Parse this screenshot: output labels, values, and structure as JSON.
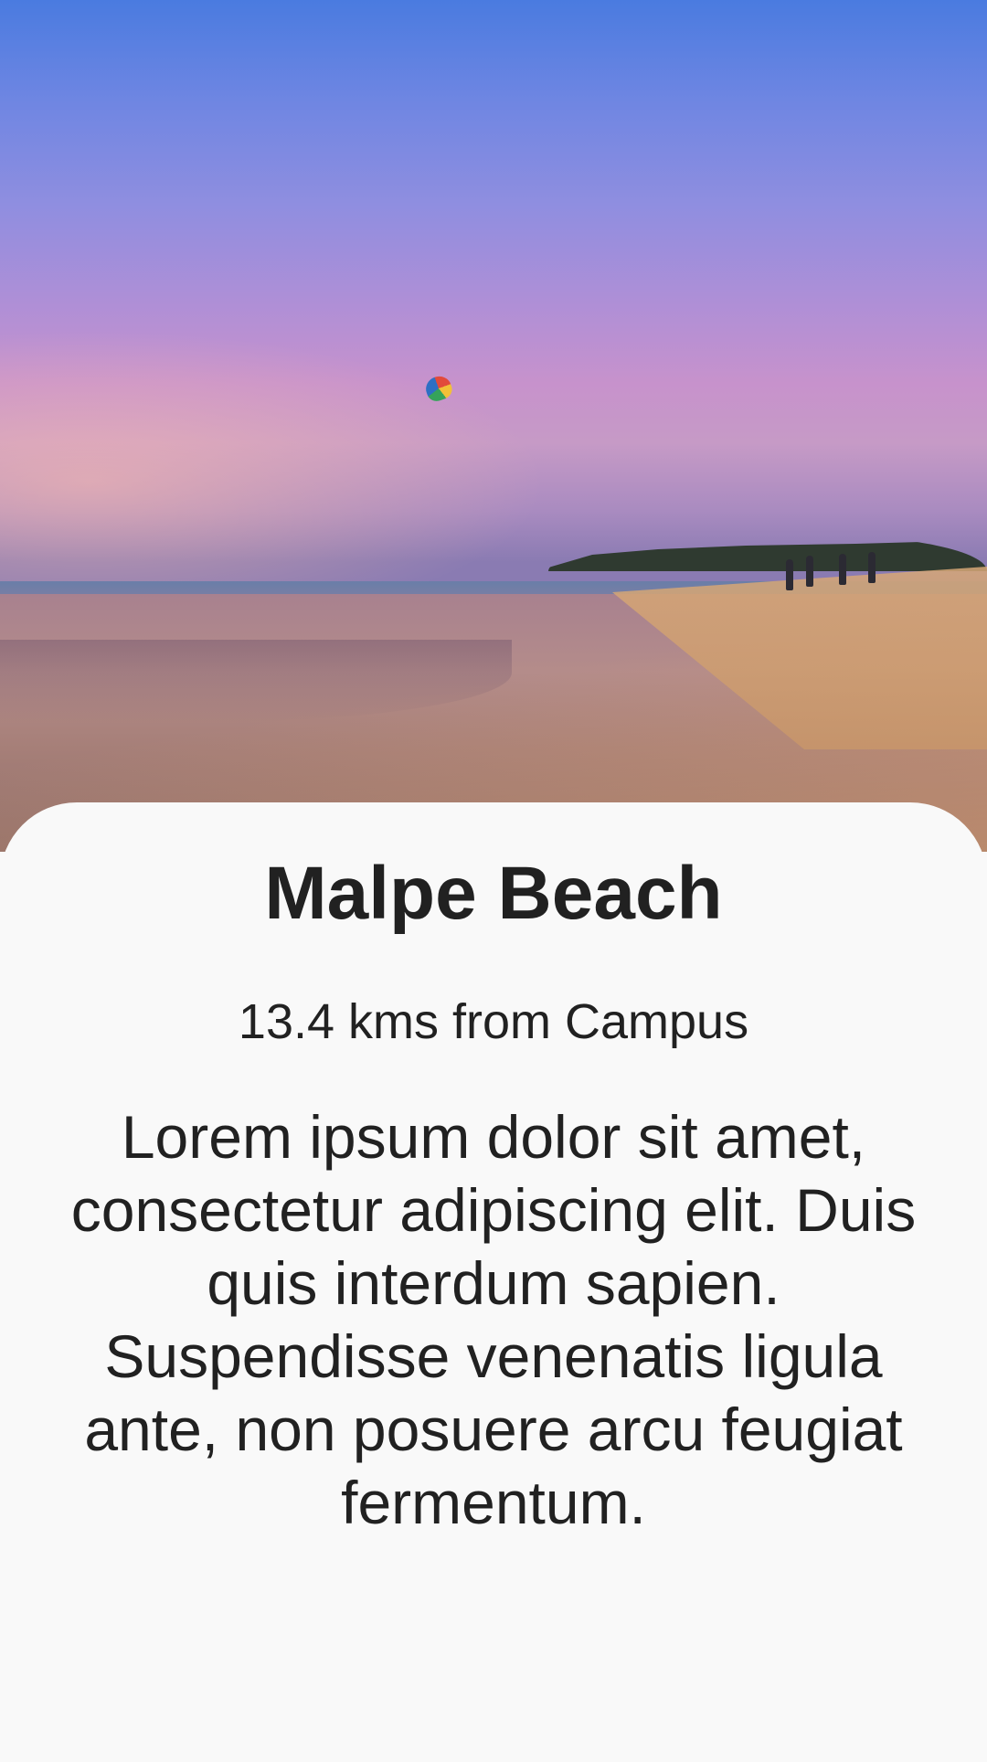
{
  "place": {
    "name": "Malpe Beach",
    "distance": "13.4 kms from Campus",
    "description": "Lorem ipsum dolor sit amet, consectetur adipiscing elit. Duis quis interdum sapien. Suspendisse venenatis ligula ante, non posuere arcu feugiat fermentum."
  },
  "colors": {
    "text": "#212121",
    "background": "#f9f9f9"
  }
}
